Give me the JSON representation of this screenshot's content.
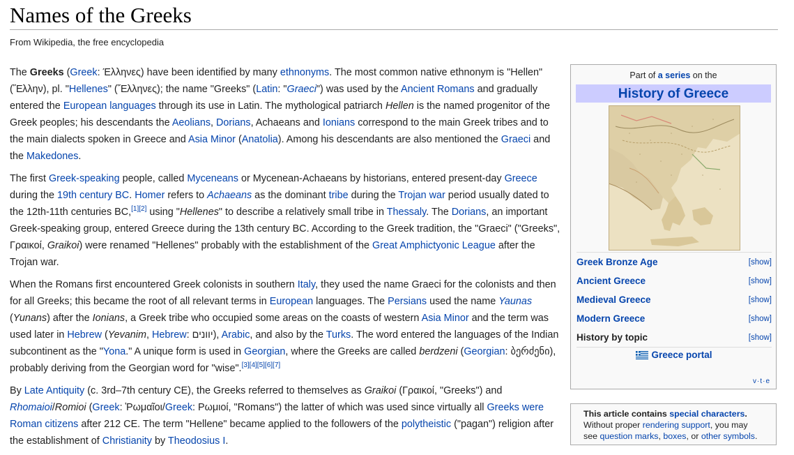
{
  "page": {
    "title": "Names of the Greeks",
    "tagline": "From Wikipedia, the free encyclopedia"
  },
  "paragraphs": [
    [
      {
        "t": "The "
      },
      {
        "t": "Greeks",
        "s": "b"
      },
      {
        "t": " ("
      },
      {
        "t": "Greek",
        "s": "a"
      },
      {
        "t": ": Έλληνες) have been identified by many "
      },
      {
        "t": "ethnonyms",
        "s": "a"
      },
      {
        "t": ". The most common native ethnonym is \"Hellen\" (Ἕλλην), pl. \""
      },
      {
        "t": "Hellenes",
        "s": "a"
      },
      {
        "t": "\" (Ἕλληνες); the name \"Greeks\" ("
      },
      {
        "t": "Latin",
        "s": "a"
      },
      {
        "t": ": \""
      },
      {
        "t": "Graeci",
        "s": "ai"
      },
      {
        "t": "\") was used by the "
      },
      {
        "t": "Ancient Romans",
        "s": "a"
      },
      {
        "t": " and gradually entered the "
      },
      {
        "t": "European languages",
        "s": "a"
      },
      {
        "t": " through its use in Latin. The mythological patriarch "
      },
      {
        "t": "Hellen",
        "s": "i"
      },
      {
        "t": " is the named progenitor of the Greek peoples; his descendants the "
      },
      {
        "t": "Aeolians",
        "s": "a"
      },
      {
        "t": ", "
      },
      {
        "t": "Dorians",
        "s": "a"
      },
      {
        "t": ", Achaeans and "
      },
      {
        "t": "Ionians",
        "s": "a"
      },
      {
        "t": " correspond to the main Greek tribes and to the main dialects spoken in Greece and "
      },
      {
        "t": "Asia Minor",
        "s": "a"
      },
      {
        "t": " ("
      },
      {
        "t": "Anatolia",
        "s": "a"
      },
      {
        "t": "). Among his descendants are also mentioned the "
      },
      {
        "t": "Graeci",
        "s": "a"
      },
      {
        "t": " and the "
      },
      {
        "t": "Makedones",
        "s": "a"
      },
      {
        "t": "."
      }
    ],
    [
      {
        "t": "The first "
      },
      {
        "t": "Greek-speaking",
        "s": "a"
      },
      {
        "t": " people, called "
      },
      {
        "t": "Myceneans",
        "s": "a"
      },
      {
        "t": " or Mycenean-Achaeans by historians, entered present-day "
      },
      {
        "t": "Greece",
        "s": "a"
      },
      {
        "t": " during the "
      },
      {
        "t": "19th century BC",
        "s": "a"
      },
      {
        "t": ". "
      },
      {
        "t": "Homer",
        "s": "a"
      },
      {
        "t": " refers to "
      },
      {
        "t": "Achaeans",
        "s": "ai"
      },
      {
        "t": " as the dominant "
      },
      {
        "t": "tribe",
        "s": "a"
      },
      {
        "t": " during the "
      },
      {
        "t": "Trojan war",
        "s": "a"
      },
      {
        "t": " period usually dated to the 12th-11th centuries BC,"
      },
      {
        "t": "[1][2]",
        "s": "sup"
      },
      {
        "t": " using \""
      },
      {
        "t": "Hellenes",
        "s": "i"
      },
      {
        "t": "\" to describe a relatively small tribe in "
      },
      {
        "t": "Thessaly",
        "s": "a"
      },
      {
        "t": ". The "
      },
      {
        "t": "Dorians",
        "s": "a"
      },
      {
        "t": ", an important Greek-speaking group, entered Greece during the 13th century BC. According to the Greek tradition, the \"Graeci\" (\"Greeks\", Γραικοί, "
      },
      {
        "t": "Graikoi",
        "s": "i"
      },
      {
        "t": ") were renamed \"Hellenes\" probably with the establishment of the "
      },
      {
        "t": "Great Amphictyonic League",
        "s": "a"
      },
      {
        "t": " after the Trojan war."
      }
    ],
    [
      {
        "t": "When the Romans first encountered Greek colonists in southern "
      },
      {
        "t": "Italy",
        "s": "a"
      },
      {
        "t": ", they used the name Graeci for the colonists and then for all Greeks; this became the root of all relevant terms in "
      },
      {
        "t": "European",
        "s": "a"
      },
      {
        "t": " languages. The "
      },
      {
        "t": "Persians",
        "s": "a"
      },
      {
        "t": " used the name "
      },
      {
        "t": "Yaunas",
        "s": "ai"
      },
      {
        "t": " ("
      },
      {
        "t": "Yunans",
        "s": "i"
      },
      {
        "t": ") after the "
      },
      {
        "t": "Ionians",
        "s": "i"
      },
      {
        "t": ", a Greek tribe who occupied some areas on the coasts of western "
      },
      {
        "t": "Asia Minor",
        "s": "a"
      },
      {
        "t": " and the term was used later in "
      },
      {
        "t": "Hebrew",
        "s": "a"
      },
      {
        "t": " ("
      },
      {
        "t": "Yevanim",
        "s": "i"
      },
      {
        "t": ", "
      },
      {
        "t": "Hebrew",
        "s": "a"
      },
      {
        "t": ": יוונים), "
      },
      {
        "t": "Arabic",
        "s": "a"
      },
      {
        "t": ", and also by the "
      },
      {
        "t": "Turks",
        "s": "a"
      },
      {
        "t": ". The word entered the languages of the Indian subcontinent as the \""
      },
      {
        "t": "Yona",
        "s": "a"
      },
      {
        "t": ".\" A unique form is used in "
      },
      {
        "t": "Georgian",
        "s": "a"
      },
      {
        "t": ", where the Greeks are called "
      },
      {
        "t": "berdzeni",
        "s": "i"
      },
      {
        "t": " ("
      },
      {
        "t": "Georgian",
        "s": "a"
      },
      {
        "t": ": ბერძენი), probably deriving from the Georgian word for \"wise\"."
      },
      {
        "t": "[3][4][5][6][7]",
        "s": "sup"
      }
    ],
    [
      {
        "t": "By "
      },
      {
        "t": "Late Antiquity",
        "s": "a"
      },
      {
        "t": " (c. 3rd–7th century CE), the Greeks referred to themselves as "
      },
      {
        "t": "Graikoi",
        "s": "i"
      },
      {
        "t": " (Γραικοί, \"Greeks\") and "
      },
      {
        "t": "Rhomaioi",
        "s": "ai"
      },
      {
        "t": "/"
      },
      {
        "t": "Romioi",
        "s": "i"
      },
      {
        "t": " ("
      },
      {
        "t": "Greek",
        "s": "a"
      },
      {
        "t": ": Ῥωμαῖοι/"
      },
      {
        "t": "Greek",
        "s": "a"
      },
      {
        "t": ": Ρωμιοί, \"Romans\") the latter of which was used since virtually all "
      },
      {
        "t": "Greeks were Roman citizens",
        "s": "a"
      },
      {
        "t": " after 212 CE. The term \"Hellene\" became applied to the followers of the "
      },
      {
        "t": "polytheistic",
        "s": "a"
      },
      {
        "t": " (\"pagan\") religion after the establishment of "
      },
      {
        "t": "Christianity",
        "s": "a"
      },
      {
        "t": " by "
      },
      {
        "t": "Theodosius I",
        "s": "a"
      },
      {
        "t": "."
      }
    ]
  ],
  "sidebar": {
    "part_of_prefix": "Part of",
    "part_of_link": "a series",
    "part_of_suffix": "on the",
    "title": "History of Greece",
    "map_icon": "map-of-greece-image",
    "sections": [
      {
        "label": "Greek Bronze Age",
        "toggle": "[show]",
        "link": true
      },
      {
        "label": "Ancient Greece",
        "toggle": "[show]",
        "link": true
      },
      {
        "label": "Medieval Greece",
        "toggle": "[show]",
        "link": true
      },
      {
        "label": "Modern Greece",
        "toggle": "[show]",
        "link": true
      },
      {
        "label": "History by topic",
        "toggle": "[show]",
        "link": false
      }
    ],
    "portal_icon": "greek-flag-icon",
    "portal_label": "Greece portal",
    "vte": [
      "v",
      "t",
      "e"
    ]
  },
  "special_box": {
    "line1_prefix": "This article contains",
    "line1_link": "special characters",
    "line1_suffix": ".",
    "line2_prefix": "Without proper",
    "line2_link": "rendering support",
    "line2_suffix": ", you may",
    "line3_prefix": "see",
    "line3_link1": "question marks",
    "line3_sep1": ",",
    "line3_link2": "boxes",
    "line3_sep2": ", or",
    "line3_link3": "other symbols",
    "line3_suffix": "."
  },
  "colors": {
    "link": "#0645ad",
    "title_band": "#ccccff",
    "box_bg": "#f9f9f9",
    "box_border": "#aaaaaa"
  }
}
